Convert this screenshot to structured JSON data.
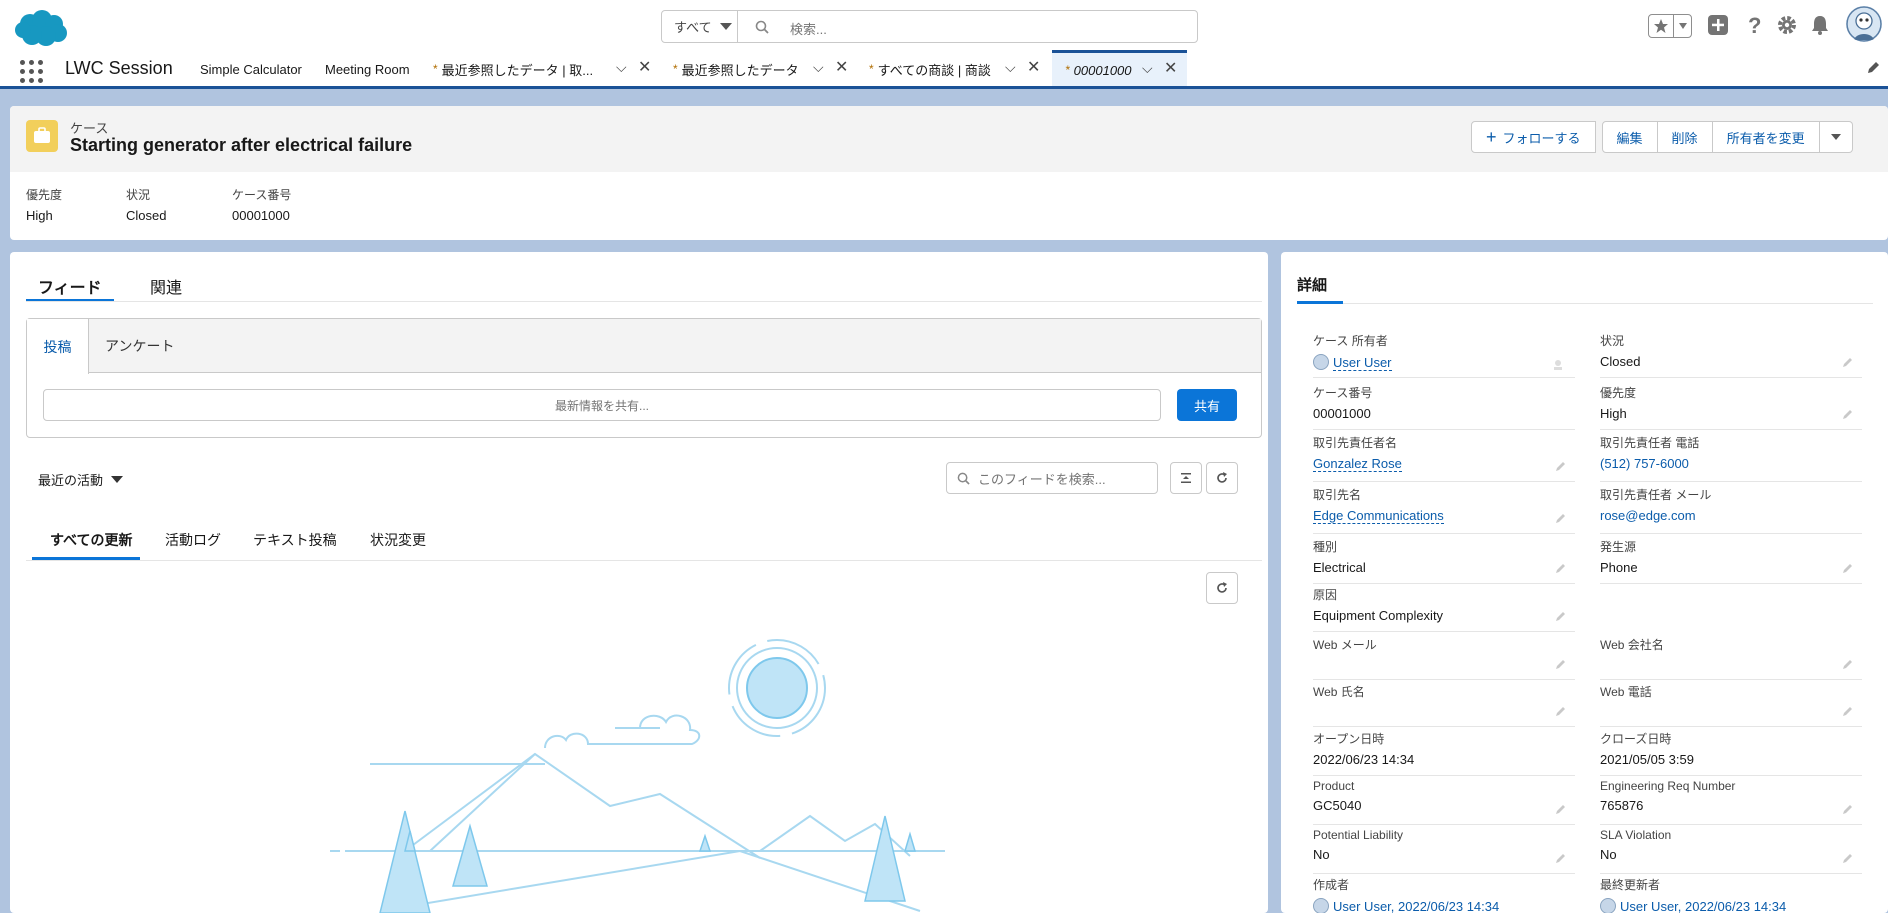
{
  "global_header": {
    "search_scope": "すべて",
    "search_placeholder": "検索..."
  },
  "nav": {
    "app_name": "LWC Session",
    "tabs": [
      {
        "label": "Simple Calculator"
      },
      {
        "label": "Meeting Room"
      },
      {
        "label": "最近参照したデータ | 取..."
      },
      {
        "label": "最近参照したデータ"
      },
      {
        "label": "すべての商談 | 商談"
      },
      {
        "label": "00001000"
      }
    ]
  },
  "record": {
    "object_label": "ケース",
    "title": "Starting generator after electrical failure",
    "actions": [
      "フォローする",
      "編集",
      "削除",
      "所有者を変更"
    ],
    "highlights": [
      {
        "label": "優先度",
        "value": "High"
      },
      {
        "label": "状況",
        "value": "Closed"
      },
      {
        "label": "ケース番号",
        "value": "00001000"
      }
    ]
  },
  "feed": {
    "tabs": [
      "フィード",
      "関連"
    ],
    "publisher_tabs": [
      "投稿",
      "アンケート"
    ],
    "publisher_placeholder": "最新情報を共有...",
    "share_label": "共有",
    "sort_label": "最近の活動",
    "search_placeholder": "このフィードを検索...",
    "filter_tabs": [
      "すべての更新",
      "活動ログ",
      "テキスト投稿",
      "状況変更"
    ]
  },
  "details": {
    "tab": "詳細",
    "fields": [
      {
        "label": "ケース 所有者",
        "value": "User User"
      },
      {
        "label": "状況",
        "value": "Closed"
      },
      {
        "label": "ケース番号",
        "value": "00001000"
      },
      {
        "label": "優先度",
        "value": "High"
      },
      {
        "label": "取引先責任者名",
        "value": "Gonzalez Rose"
      },
      {
        "label": "取引先責任者 電話",
        "value": "(512) 757-6000"
      },
      {
        "label": "取引先名",
        "value": "Edge Communications"
      },
      {
        "label": "取引先責任者 メール",
        "value": "rose@edge.com"
      },
      {
        "label": "種別",
        "value": "Electrical"
      },
      {
        "label": "発生源",
        "value": "Phone"
      },
      {
        "label": "原因",
        "value": "Equipment Complexity"
      },
      {
        "label": "Web メール",
        "value": ""
      },
      {
        "label": "Web 会社名",
        "value": ""
      },
      {
        "label": "Web 氏名",
        "value": ""
      },
      {
        "label": "Web 電話",
        "value": ""
      },
      {
        "label": "オープン日時",
        "value": "2022/06/23 14:34"
      },
      {
        "label": "クローズ日時",
        "value": "2021/05/05 3:59"
      },
      {
        "label": "Product",
        "value": "GC5040"
      },
      {
        "label": "Engineering Req Number",
        "value": "765876"
      },
      {
        "label": "Potential Liability",
        "value": "No"
      },
      {
        "label": "SLA Violation",
        "value": "No"
      },
      {
        "label": "作成者",
        "value": "User User, 2022/06/23 14:34"
      },
      {
        "label": "最終更新者",
        "value": "User User, 2022/06/23 14:34"
      }
    ]
  },
  "colors": {
    "brand": "#0b75d8",
    "nav_border": "#1b5297",
    "case_icon": "#f2cf5b"
  }
}
